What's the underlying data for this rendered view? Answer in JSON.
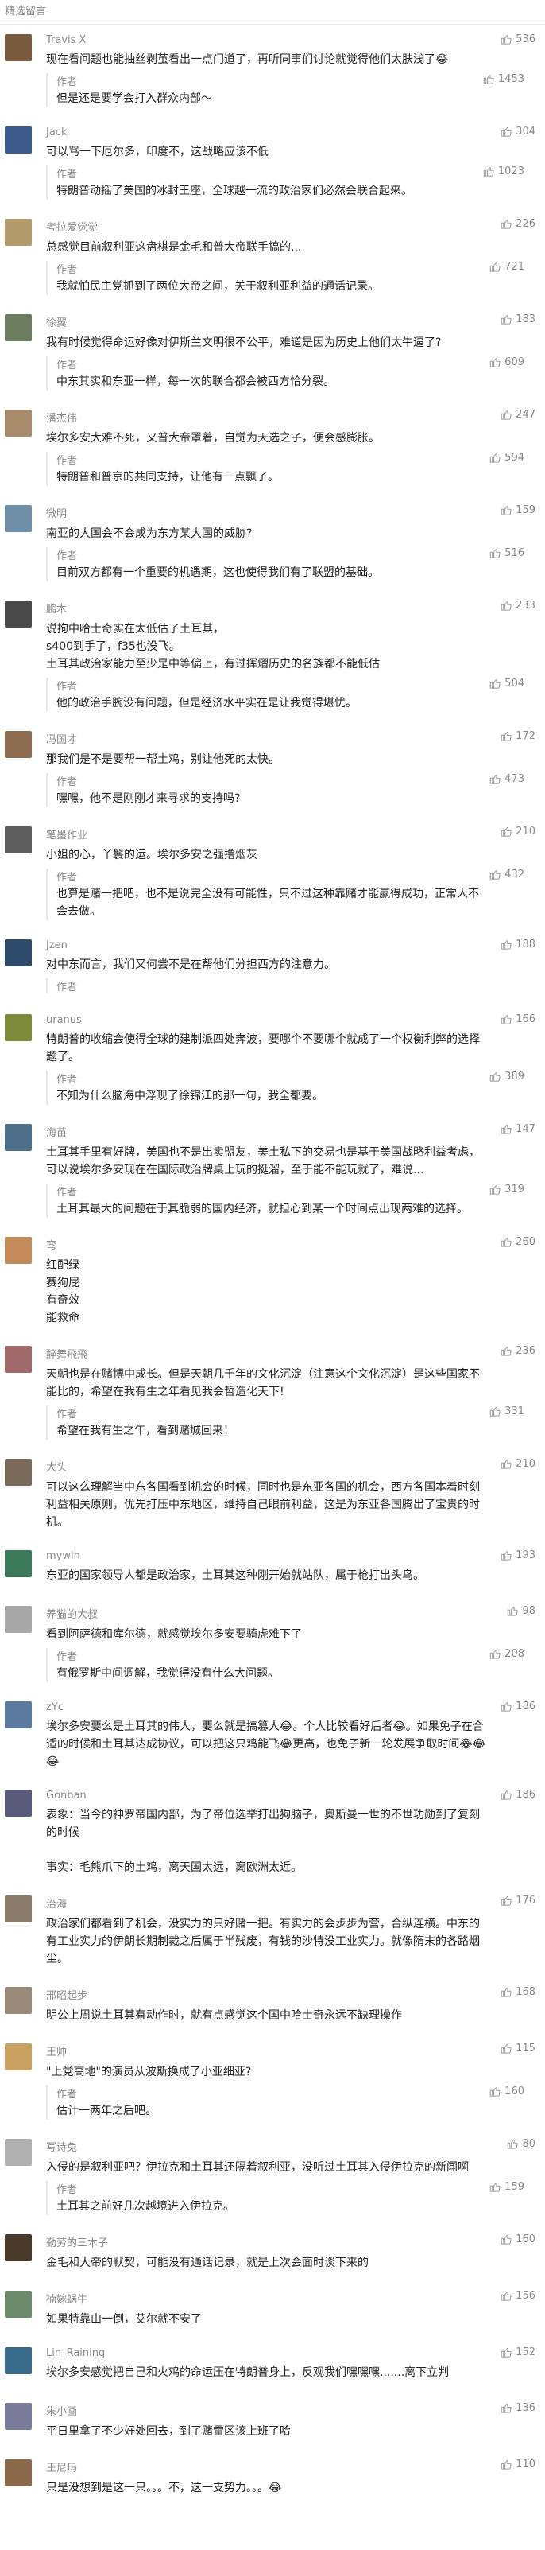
{
  "header": {
    "title": "精选留言"
  },
  "comments": [
    {
      "name": "Travis X",
      "likes": "536",
      "color": "#7a5a3c",
      "text": "现在看问题也能抽丝剥茧看出一点门道了，再听同事们讨论就觉得他们太肤浅了😂",
      "author": "作者",
      "reply_likes": "1453",
      "reply": "但是还是要学会打入群众内部～"
    },
    {
      "name": "Jack",
      "likes": "304",
      "color": "#3d5a8c",
      "text": "可以骂一下厄尔多，印度不，这战略应该不低",
      "author": "作者",
      "reply_likes": "1023",
      "reply": "特朗普动摇了美国的冰封王座，全球越一流的政治家们必然会联合起来。"
    },
    {
      "name": "考拉爱觉觉",
      "likes": "226",
      "color": "#b39b6b",
      "text": "总感觉目前叙利亚这盘棋是金毛和普大帝联手搞的...",
      "author": "作者",
      "reply_likes": "721",
      "reply": "我就怕民主党抓到了两位大帝之间，关于叙利亚利益的通话记录。"
    },
    {
      "name": "徐翼",
      "likes": "183",
      "color": "#6a7b5e",
      "text": "我有时候觉得命运好像对伊斯兰文明很不公平，难道是因为历史上他们太牛逼了?",
      "author": "作者",
      "reply_likes": "609",
      "reply": "中东其实和东亚一样，每一次的联合都会被西方恰分裂。"
    },
    {
      "name": "潘杰伟",
      "likes": "247",
      "color": "#a88b6a",
      "text": "埃尔多安大难不死，又普大帝罩着，自觉为天选之子，便会感膨胀。",
      "author": "作者",
      "reply_likes": "594",
      "reply": "特朗普和普京的共同支持，让他有一点飘了。"
    },
    {
      "name": "微明",
      "likes": "159",
      "color": "#6f8fa8",
      "text": "南亚的大国会不会成为东方某大国的威胁?",
      "author": "作者",
      "reply_likes": "516",
      "reply": "目前双方都有一个重要的机遇期，这也使得我们有了联盟的基础。"
    },
    {
      "name": "鹏木",
      "likes": "233",
      "color": "#4a4a4a",
      "text": "说拘中哈士奇实在太低估了土耳其，\ns400到手了，f35也没飞。\n土耳其政治家能力至少是中等偏上，有过挥熠历史的名族都不能低估",
      "author": "作者",
      "reply_likes": "504",
      "reply": "他的政治手腕没有问题，但是经济水平实在是让我觉得堪忧。"
    },
    {
      "name": "冯国才",
      "likes": "172",
      "color": "#8c6b4f",
      "text": "那我们是不是要帮一帮土鸡，别让他死的太快。",
      "author": "作者",
      "reply_likes": "473",
      "reply": "嘿嘿，他不是刚刚才来寻求的支持吗?"
    },
    {
      "name": "笔墨作业",
      "likes": "210",
      "color": "#5e5e5e",
      "text": "小姐的心，丫鬟的运。埃尔多安之强撸烟灰",
      "author": "作者",
      "reply_likes": "432",
      "reply": "也算是赌一把吧，也不是说完全没有可能性，只不过这种靠赌才能赢得成功，正常人不会去做。"
    },
    {
      "name": "Jzen",
      "likes": "188",
      "color": "#2e4a6b",
      "text": "对中东而言，我们又何尝不是在帮他们分担西方的注意力。",
      "author": "作者",
      "reply_likes": "",
      "reply": ""
    },
    {
      "name": "uranus",
      "likes": "166",
      "color": "#7c8a3a",
      "text": "特朗普的收缩会使得全球的建制派四处奔波，要哪个不要哪个就成了一个权衡利弊的选择题了。",
      "author": "作者",
      "reply_likes": "389",
      "reply": "不知为什么脑海中浮现了徐锦江的那一句，我全都要。"
    },
    {
      "name": "海苗",
      "likes": "147",
      "color": "#4d6f8a",
      "text": "土耳其手里有好牌，美国也不是出卖盟友，美土私下的交易也是基于美国战略利益考虑，可以说埃尔多安现在在国际政治牌桌上玩的挺溜，至于能不能玩就了，难说...",
      "author": "作者",
      "reply_likes": "319",
      "reply": "土耳其最大的问题在于其脆弱的国内经济，就担心到某一个时间点出现两难的选择。"
    },
    {
      "name": "弯",
      "likes": "260",
      "color": "#c48b5a",
      "text": "红配绿\n赛狗屁\n有奇效\n能救命",
      "author": "",
      "reply_likes": "",
      "reply": ""
    },
    {
      "name": "醉舞飛飛",
      "likes": "236",
      "color": "#a06a6a",
      "text": "天朝也是在赌博中成长。但是天朝几千年的文化沉淀（注意这个文化沉淀）是这些国家不能比的，希望在我有生之年看见我会哲造化天下!",
      "author": "作者",
      "reply_likes": "331",
      "reply": "希望在我有生之年，看到赌城回来！"
    },
    {
      "name": "大头",
      "likes": "210",
      "color": "#7a6a5a",
      "text": "可以这么理解当中东各国看到机会的时候，同时也是东亚各国的机会，西方各国本着时刻利益相关原则，优先打压中东地区，维持自己眼前利益，这是为东亚各国腾出了宝贵的时机。",
      "author": "",
      "reply_likes": "",
      "reply": ""
    },
    {
      "name": "mywin",
      "likes": "193",
      "color": "#3a7a5a",
      "text": "东亚的国家领导人都是政治家，土耳其这种刚开始就站队，属于枪打出头鸟。",
      "author": "",
      "reply_likes": "",
      "reply": ""
    },
    {
      "name": "养猫的大叔",
      "likes": "98",
      "color": "#a8a8a8",
      "text": "看到阿萨德和库尔德，就感觉埃尔多安要骑虎难下了",
      "author": "作者",
      "reply_likes": "208",
      "reply": "有俄罗斯中间调解，我觉得没有什么大问题。"
    },
    {
      "name": "zYc",
      "likes": "186",
      "color": "#5a7aa0",
      "text": "埃尔多安要么是土耳其的伟人，要么就是搞篡人😂。个人比较看好后者😂。如果免子在合适的时候和土耳其达成协议，可以把这只鸡能飞😂更高，也免子新一轮发展争取时间😂😂😂",
      "author": "",
      "reply_likes": "",
      "reply": ""
    },
    {
      "name": "Gonban",
      "likes": "186",
      "color": "#5a5a7a",
      "text": "表象：当今的神罗帝国内部，为了帝位选举打出狗脑子，奥斯曼一世的不世功勋到了复刻的时候\n\n事实：毛熊爪下的土鸡，离天国太远，离欧洲太近。",
      "author": "",
      "reply_likes": "",
      "reply": ""
    },
    {
      "name": "治海",
      "likes": "176",
      "color": "#8a7a6a",
      "text": "政治家们都看到了机会，没实力的只好赌一把。有实力的会步步为营，合纵连横。中东的有工业实力的伊朗长期制裁之后属于半残废，有钱的沙特没工业实力。就像隋末的各路烟尘。",
      "author": "",
      "reply_likes": "",
      "reply": ""
    },
    {
      "name": "邢昭起步",
      "likes": "168",
      "color": "#9a8a7a",
      "text": "明公上周说土耳其有动作时，就有点感觉这个国中哈士奇永远不缺理操作",
      "author": "",
      "reply_likes": "",
      "reply": ""
    },
    {
      "name": "王帅",
      "likes": "115",
      "color": "#c8a060",
      "text": "\"上党高地\"的演员从波斯换成了小亚细亚?",
      "author": "作者",
      "reply_likes": "160",
      "reply": "估计一两年之后吧。"
    },
    {
      "name": "写诗兔",
      "likes": "80",
      "color": "#b0b0b0",
      "text": "入侵的是叙利亚吧？伊拉克和土耳其还隔着叙利亚，没听过土耳其入侵伊拉克的新闻啊",
      "author": "作者",
      "reply_likes": "159",
      "reply": "土耳其之前好几次越境进入伊拉克。"
    },
    {
      "name": "勤劳的三木子",
      "likes": "160",
      "color": "#4a3a2a",
      "text": "金毛和大帝的默契，可能没有通话记录，就是上次会面时谈下来的",
      "author": "",
      "reply_likes": "",
      "reply": ""
    },
    {
      "name": "楠嫁蜗牛",
      "likes": "156",
      "color": "#6a8a6a",
      "text": "如果特靠山一倒，艾尔就不安了",
      "author": "",
      "reply_likes": "",
      "reply": ""
    },
    {
      "name": "Lin_Raining",
      "likes": "152",
      "color": "#3a6a8a",
      "text": "埃尔多安感觉把自己和火鸡的命运压在特朗普身上，反观我们嘿嘿嘿.......离下立判",
      "author": "",
      "reply_likes": "",
      "reply": ""
    },
    {
      "name": "朱小画",
      "likes": "136",
      "color": "#7a7a9a",
      "text": "平日里拿了不少好处回去，到了赌雷区该上班了哈",
      "author": "",
      "reply_likes": "",
      "reply": ""
    },
    {
      "name": "王尼玛",
      "likes": "110",
      "color": "#8a6a4a",
      "text": "只是没想到是这一只。。。不，这一支势力。。。😂",
      "author": "",
      "reply_likes": "",
      "reply": ""
    }
  ]
}
